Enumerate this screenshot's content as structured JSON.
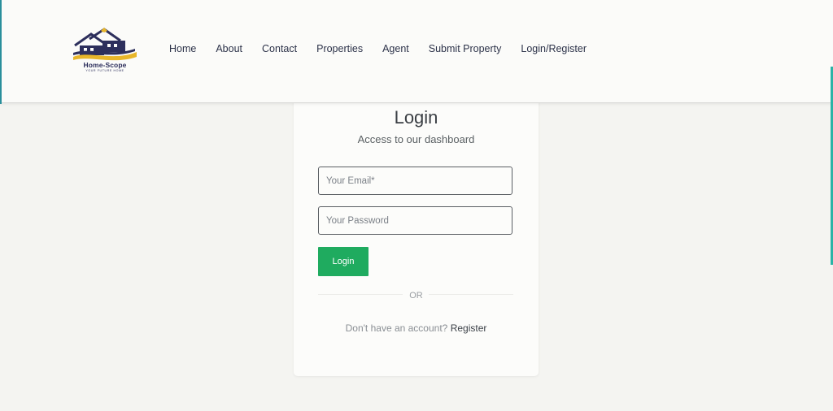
{
  "header": {
    "logo": {
      "name": "Home-Scope",
      "tagline": "YOUR FUTURE HOME",
      "colors": {
        "navy": "#2d2f5c",
        "gold": "#e8b62a"
      }
    },
    "nav": [
      {
        "label": "Home"
      },
      {
        "label": "About"
      },
      {
        "label": "Contact"
      },
      {
        "label": "Properties"
      },
      {
        "label": "Agent"
      },
      {
        "label": "Submit Property"
      },
      {
        "label": "Login/Register"
      }
    ]
  },
  "login_card": {
    "title": "Login",
    "subtitle": "Access to our dashboard",
    "email": {
      "value": "",
      "placeholder": "Your Email*"
    },
    "password": {
      "value": "",
      "placeholder": "Your Password"
    },
    "submit_label": "Login",
    "divider_text": "OR",
    "footer_prompt": "Don't have an account?",
    "register_label": "Register"
  },
  "colors": {
    "accent_green": "#1fab5f",
    "page_background": "#f4f4f1",
    "accent_teal": "#2bb3a6"
  }
}
